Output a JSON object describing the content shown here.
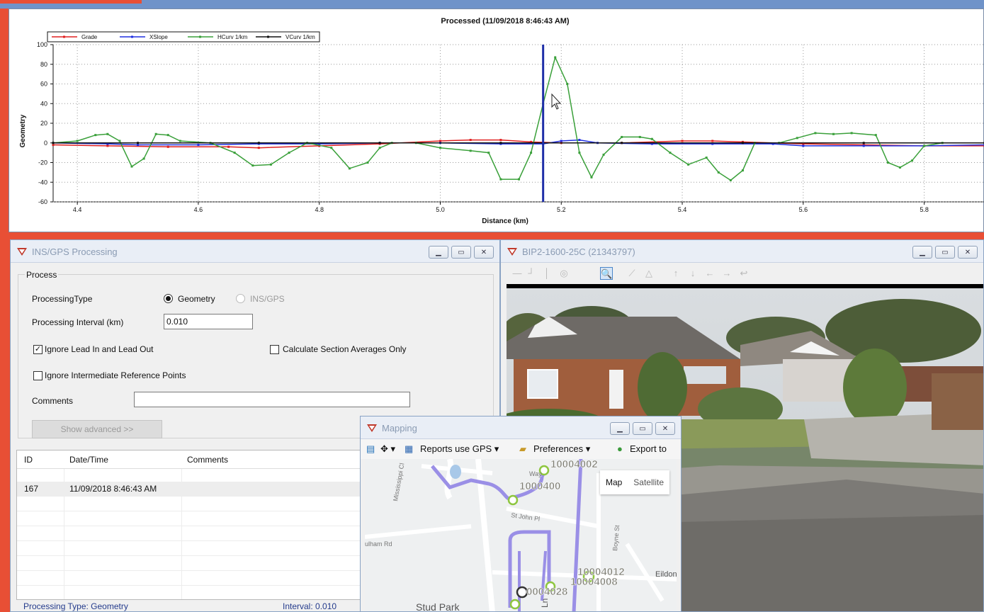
{
  "chart_data": {
    "type": "line",
    "title": "Processed (11/09/2018 8:46:43 AM)",
    "xlabel": "Distance (km)",
    "ylabel": "Geometry",
    "xlim": [
      4.36,
      5.9
    ],
    "ylim": [
      -60,
      100
    ],
    "xticks": [
      "4.4",
      "4.6",
      "4.8",
      "5.0",
      "5.2",
      "5.4",
      "5.6",
      "5.8"
    ],
    "yticks": [
      "100",
      "80",
      "60",
      "40",
      "20",
      "0",
      "-20",
      "-40",
      "-60"
    ],
    "grid": true,
    "legend": "top-left",
    "cursor_x": 5.17,
    "series": [
      {
        "name": "Grade",
        "color": "#e02020",
        "points": [
          [
            4.36,
            -2
          ],
          [
            4.45,
            -3
          ],
          [
            4.55,
            -4
          ],
          [
            4.65,
            -4
          ],
          [
            4.7,
            -5
          ],
          [
            4.8,
            -3
          ],
          [
            4.9,
            -1
          ],
          [
            5.0,
            2
          ],
          [
            5.05,
            3
          ],
          [
            5.1,
            3
          ],
          [
            5.15,
            1
          ],
          [
            5.2,
            0
          ],
          [
            5.3,
            0
          ],
          [
            5.4,
            2
          ],
          [
            5.45,
            2
          ],
          [
            5.5,
            1
          ],
          [
            5.6,
            -1
          ],
          [
            5.7,
            -2
          ],
          [
            5.8,
            -3
          ],
          [
            5.9,
            -3
          ]
        ]
      },
      {
        "name": "XSlope",
        "color": "#2030e0",
        "points": [
          [
            4.36,
            0
          ],
          [
            4.45,
            -1
          ],
          [
            4.5,
            -2
          ],
          [
            4.6,
            -2
          ],
          [
            4.7,
            -1
          ],
          [
            4.8,
            -1
          ],
          [
            4.9,
            0
          ],
          [
            5.0,
            0
          ],
          [
            5.1,
            -1
          ],
          [
            5.17,
            -1
          ],
          [
            5.2,
            2
          ],
          [
            5.23,
            3
          ],
          [
            5.26,
            0
          ],
          [
            5.35,
            -1
          ],
          [
            5.45,
            -1
          ],
          [
            5.55,
            -1
          ],
          [
            5.6,
            -3
          ],
          [
            5.7,
            -3
          ],
          [
            5.8,
            -3
          ],
          [
            5.9,
            -2
          ]
        ]
      },
      {
        "name": "HCurv 1/km",
        "color": "#3aa03a",
        "points": [
          [
            4.36,
            0
          ],
          [
            4.4,
            2
          ],
          [
            4.43,
            8
          ],
          [
            4.45,
            9
          ],
          [
            4.47,
            2
          ],
          [
            4.49,
            -24
          ],
          [
            4.51,
            -16
          ],
          [
            4.53,
            9
          ],
          [
            4.55,
            8
          ],
          [
            4.57,
            2
          ],
          [
            4.62,
            0
          ],
          [
            4.66,
            -10
          ],
          [
            4.69,
            -23
          ],
          [
            4.72,
            -22
          ],
          [
            4.75,
            -10
          ],
          [
            4.78,
            0
          ],
          [
            4.82,
            -5
          ],
          [
            4.85,
            -26
          ],
          [
            4.88,
            -20
          ],
          [
            4.9,
            -5
          ],
          [
            4.92,
            0
          ],
          [
            4.96,
            0
          ],
          [
            5.0,
            -5
          ],
          [
            5.05,
            -8
          ],
          [
            5.08,
            -10
          ],
          [
            5.1,
            -37
          ],
          [
            5.13,
            -37
          ],
          [
            5.15,
            -10
          ],
          [
            5.17,
            40
          ],
          [
            5.19,
            87
          ],
          [
            5.21,
            60
          ],
          [
            5.23,
            -10
          ],
          [
            5.25,
            -35
          ],
          [
            5.27,
            -12
          ],
          [
            5.3,
            6
          ],
          [
            5.33,
            6
          ],
          [
            5.35,
            4
          ],
          [
            5.38,
            -10
          ],
          [
            5.41,
            -22
          ],
          [
            5.44,
            -15
          ],
          [
            5.46,
            -30
          ],
          [
            5.48,
            -38
          ],
          [
            5.5,
            -28
          ],
          [
            5.52,
            0
          ],
          [
            5.56,
            0
          ],
          [
            5.59,
            5
          ],
          [
            5.62,
            10
          ],
          [
            5.65,
            9
          ],
          [
            5.68,
            10
          ],
          [
            5.72,
            8
          ],
          [
            5.74,
            -20
          ],
          [
            5.76,
            -25
          ],
          [
            5.78,
            -18
          ],
          [
            5.8,
            -3
          ],
          [
            5.83,
            0
          ],
          [
            5.9,
            0
          ]
        ]
      },
      {
        "name": "VCurv 1/km",
        "color": "#111111",
        "points": [
          [
            4.36,
            0
          ],
          [
            4.5,
            0
          ],
          [
            4.7,
            0
          ],
          [
            4.9,
            0
          ],
          [
            5.1,
            0
          ],
          [
            5.3,
            0
          ],
          [
            5.5,
            0
          ],
          [
            5.7,
            0
          ],
          [
            5.9,
            0
          ]
        ]
      }
    ]
  },
  "ins_window": {
    "title": "INS/GPS Processing",
    "group_title": "Process",
    "processing_type_label": "ProcessingType",
    "radio_geometry": "Geometry",
    "radio_insgps": "INS/GPS",
    "interval_label": "Processing Interval (km)",
    "interval_value": "0.010",
    "ignore_lead": "Ignore Lead In and Lead Out",
    "calc_section": "Calculate Section Averages Only",
    "ignore_intermediate": "Ignore Intermediate Reference Points",
    "comments_label": "Comments",
    "comments_value": "",
    "show_advanced": "Show advanced >>",
    "table": {
      "headers": [
        "ID",
        "Date/Time",
        "Comments"
      ],
      "rows": [
        [
          "167",
          "11/09/2018 8:46:43 AM",
          ""
        ]
      ]
    },
    "status_type": "Processing Type: Geometry",
    "status_interval": "Interval: 0.010"
  },
  "video_window": {
    "title": "BIP2-1600-25C (21343797)"
  },
  "map_window": {
    "title": "Mapping",
    "reports": "Reports use GPS",
    "preferences": "Preferences",
    "export": "Export to",
    "map_btn": "Map",
    "satellite_btn": "Satellite",
    "labels": {
      "p1": "10004002",
      "p2": "1000400",
      "p3": "10004012",
      "p4": "10004008",
      "p5": "0004028",
      "street1": "Mississippi Cl",
      "street2": "St John Pl",
      "street3": "ulham Rd",
      "street4": "Boyne St",
      "street5": "Eildon",
      "street6": "Stud Park",
      "street7": "Ln",
      "street8": "Way"
    }
  }
}
